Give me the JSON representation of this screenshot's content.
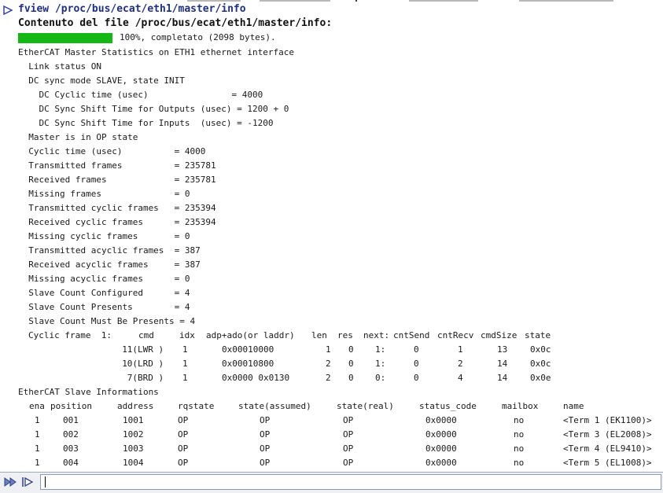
{
  "command": {
    "text": "fview /proc/bus/ecat/eth1/master/info",
    "prompt_icon": "right-arrow-icon"
  },
  "heading": "Contenuto del file /proc/bus/ecat/eth1/master/info:",
  "progress": {
    "percent": 100,
    "label": "100%, completato (2098 bytes)."
  },
  "lines": [
    "EtherCAT Master Statistics on ETH1 ethernet interface",
    "  Link status ON",
    "  DC sync mode SLAVE, state INIT",
    "    DC Cyclic time (usec)                = 4000",
    "    DC Sync Shift Time for Outputs (usec) = 1200 + 0",
    "    DC Sync Shift Time for Inputs  (usec) = -1200",
    "  Master is in OP state",
    "  Cyclic time (usec)          = 4000",
    "  Transmitted frames          = 235781",
    "  Received frames             = 235781",
    "  Missing frames              = 0",
    "  Transmitted cyclic frames   = 235394",
    "  Received cyclic frames      = 235394",
    "  Missing cyclic frames       = 0",
    "  Transmitted acyclic frames  = 387",
    "  Received acyclic frames     = 387",
    "  Missing acyclic frames      = 0",
    "  Slave Count Configured      = 4",
    "  Slave Count Presents        = 4",
    "  Slave Count Must Be Presents = 4"
  ],
  "cyclic_frame": {
    "label": "Cyclic frame  1:",
    "headers": [
      "cmd",
      "idx",
      "adp+ado(or laddr)",
      "len",
      "res",
      "next:",
      "cntSend",
      "cntRecv",
      "cmdSize",
      "state"
    ],
    "rows": [
      [
        "11(LWR )",
        "1",
        "0x00010000",
        "1",
        "0",
        "1:",
        "0",
        "1",
        "13",
        "0x0c"
      ],
      [
        "10(LRD )",
        "1",
        "0x00010800",
        "2",
        "0",
        "1:",
        "0",
        "2",
        "14",
        "0x0c"
      ],
      [
        "7(BRD )",
        "1",
        "0x0000 0x0130",
        "2",
        "0",
        "0:",
        "0",
        "4",
        "14",
        "0x0e"
      ]
    ]
  },
  "slaves": {
    "title": "EtherCAT Slave Informations",
    "headers": [
      "ena",
      "position",
      "address",
      "rqstate",
      "state(assumed)",
      "state(real)",
      "status_code",
      "mailbox",
      "name"
    ],
    "rows": [
      [
        "1",
        "001",
        "1001",
        "OP",
        "OP",
        "OP",
        "0x0000",
        "no",
        "<Term 1 (EK1100)>"
      ],
      [
        "1",
        "002",
        "1002",
        "OP",
        "OP",
        "OP",
        "0x0000",
        "no",
        "<Term 3 (EL2008)>"
      ],
      [
        "1",
        "003",
        "1003",
        "OP",
        "OP",
        "OP",
        "0x0000",
        "no",
        "<Term 4 (EL9410)>"
      ],
      [
        "1",
        "004",
        "1004",
        "OP",
        "OP",
        "OP",
        "0x0000",
        "no",
        "<Term 5 (EL1008)>"
      ]
    ]
  },
  "command_bar": {
    "icons": [
      "run-icon",
      "run-step-icon"
    ],
    "input_value": ""
  },
  "colors": {
    "command_text": "#1f2f86",
    "progress_fill": "#14b714",
    "body_text": "#1a1a1a"
  }
}
